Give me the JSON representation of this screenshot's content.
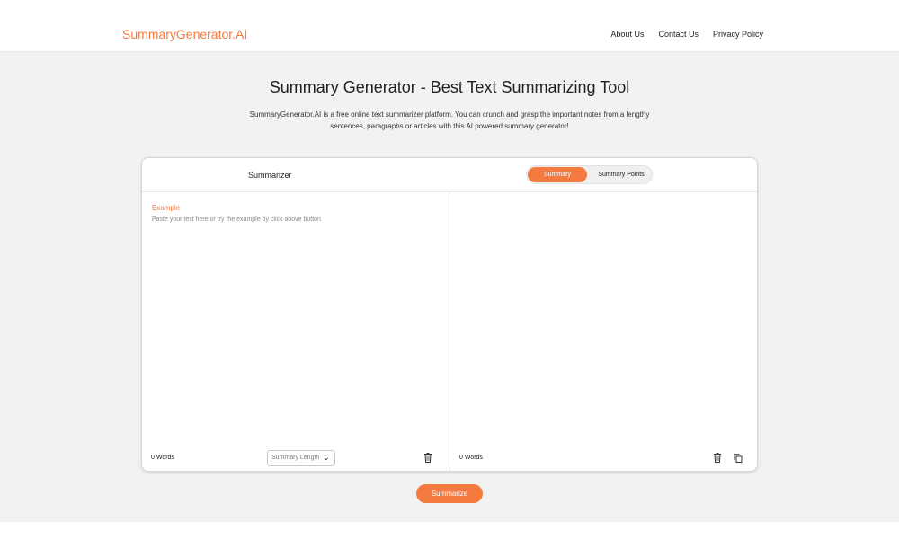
{
  "header": {
    "logo": "SummaryGenerator.AI",
    "nav": [
      "About Us",
      "Contact Us",
      "Privacy Policy"
    ]
  },
  "hero": {
    "title": "Summary Generator - Best Text Summarizing Tool",
    "subtitle": "SummaryGenerator.AI is a free online text summarizer platform. You can crunch and grasp the important notes from a lengthy sentences, paragraphs or articles with this AI powered summary generator!"
  },
  "card": {
    "left_header": "Summarizer",
    "mode_tabs": {
      "active": "Summary",
      "inactive": "Summary Points"
    },
    "example_link": "Example",
    "input_placeholder": "Paste your text here or try the example by click above button",
    "input_value": "",
    "left_word_count": "0 Words",
    "length_select": "Summary Length",
    "right_word_count": "0 Words"
  },
  "action": {
    "summarize_label": "Summarize"
  },
  "icons": {
    "delete": "trash-icon",
    "copy": "copy-icon",
    "dropdown": "chevron-down-icon"
  },
  "colors": {
    "accent": "#f47a3f",
    "page_bg": "#f2f2f2",
    "card_bg": "#ffffff"
  }
}
